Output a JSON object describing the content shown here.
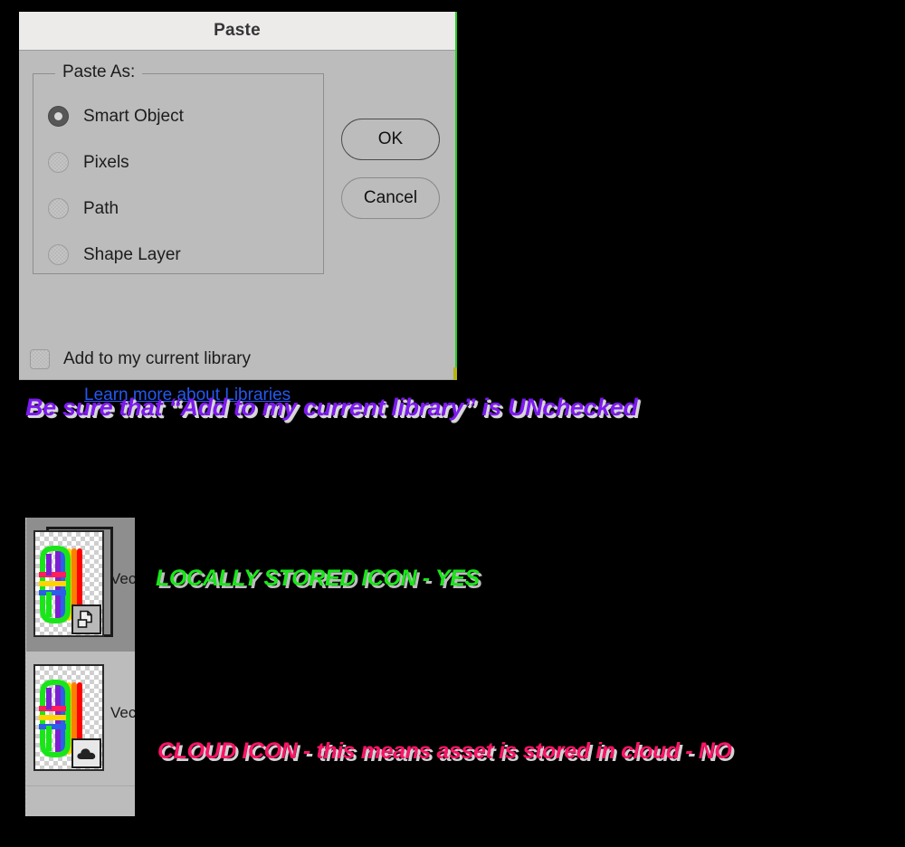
{
  "dialog": {
    "title": "Paste",
    "group_legend": "Paste As:",
    "options": [
      {
        "label": "Smart Object",
        "selected": true
      },
      {
        "label": "Pixels",
        "selected": false
      },
      {
        "label": "Path",
        "selected": false
      },
      {
        "label": "Shape Layer",
        "selected": false
      }
    ],
    "buttons": {
      "ok": "OK",
      "cancel": "Cancel"
    },
    "checkbox": {
      "label": "Add to my current library",
      "checked": false
    },
    "link": "Learn more about Libraries"
  },
  "annotations": [
    {
      "id": "unchecked",
      "text": "Be sure that “Add to my current library” is UNchecked",
      "color": "#7d19f0"
    },
    {
      "id": "locally-stored",
      "text": "LOCALLY STORED ICON - YES",
      "color": "#18e618"
    },
    {
      "id": "cloud-stored",
      "text": "CLOUD ICON - this means asset is stored in cloud - NO",
      "color": "#fb1367"
    }
  ],
  "layers_panel": {
    "rows": [
      {
        "name": "Vec",
        "badge": "smart-object-icon",
        "selected": true
      },
      {
        "name": "Vec",
        "badge": "cloud-icon",
        "selected": false
      }
    ]
  },
  "colors": {
    "dialog_background": "#bcbcbc",
    "titlebar_background": "#edeaea",
    "link": "#2558f0",
    "dialog_edge_accent": "#1ed61e",
    "selected_row": "#8e8e8e"
  }
}
